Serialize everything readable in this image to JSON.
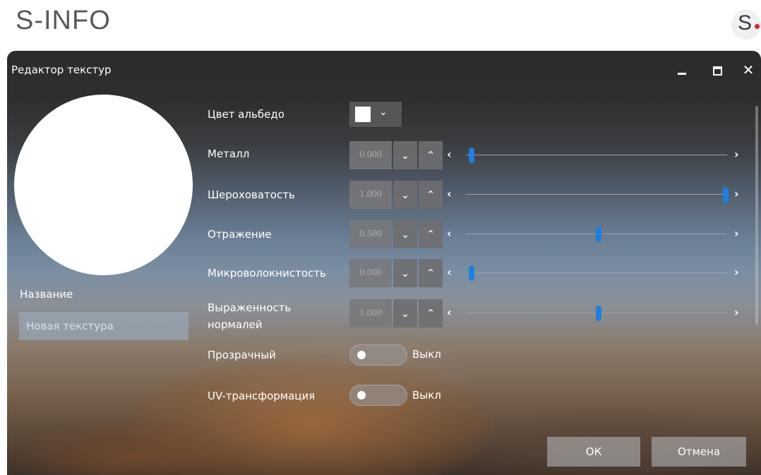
{
  "page": {
    "brand_title": "S-INFO",
    "brand_logo_letter": "S"
  },
  "window": {
    "title": "Редактор текстур",
    "controls": {
      "minimize": "–",
      "maximize": "□",
      "close": "✕"
    }
  },
  "texture": {
    "name_label": "Название",
    "name_placeholder": "Новая текстура",
    "albedo_label": "Цвет альбедо",
    "albedo_color": "#ffffff"
  },
  "params": [
    {
      "label": "Металл",
      "value": "0.000",
      "slider_fraction": 0.0
    },
    {
      "label": "Шероховатость",
      "value": "1.000",
      "slider_fraction": 1.0
    },
    {
      "label": "Отражение",
      "value": "0.500",
      "slider_fraction": 0.5
    },
    {
      "label": "Микроволокнистость",
      "value": "0.000",
      "slider_fraction": 0.0
    },
    {
      "label": "Выраженность нормалей",
      "label_line1": "Выраженность",
      "label_line2": "нормалей",
      "value": "1.000",
      "slider_fraction": 0.5
    }
  ],
  "toggles": [
    {
      "label": "Прозрачный",
      "state": "Выкл",
      "on": false
    },
    {
      "label": "UV-трансформация",
      "state": "Выкл",
      "on": false
    }
  ],
  "icons": {
    "chevron_down": "⌄",
    "chevron_up": "⌃",
    "arrow_left": "‹",
    "arrow_right": "›"
  },
  "buttons": {
    "ok": "ОК",
    "cancel": "Отмена"
  },
  "colors": {
    "slider_thumb": "#1e7fe0",
    "brand_dot": "#d9252d"
  }
}
